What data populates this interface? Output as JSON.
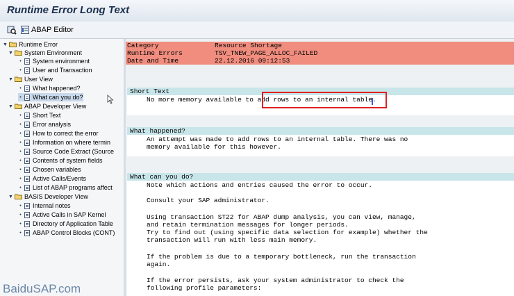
{
  "window": {
    "title": "Runtime Error Long Text"
  },
  "toolbar": {
    "abap_editor_label": "ABAP Editor"
  },
  "tree": {
    "root": "Runtime Error",
    "groups": [
      {
        "label": "System Environment",
        "items": [
          "System environment",
          "User and Transaction"
        ]
      },
      {
        "label": "User View",
        "items": [
          "What happened?",
          "What can you do?"
        ]
      },
      {
        "label": "ABAP Developer View",
        "items": [
          "Short Text",
          "Error analysis",
          "How to correct the error",
          "Information on where termin",
          "Source Code Extract (Source",
          "Contents of system fields",
          "Chosen variables",
          "Active Calls/Events",
          "List of ABAP programs affect"
        ]
      },
      {
        "label": "BASIS Developer View",
        "items": [
          "Internal notes",
          "Active Calls in SAP Kernel",
          "Directory of Application Table",
          "ABAP Control Blocks (CONT)"
        ]
      }
    ]
  },
  "header": {
    "rows": [
      {
        "label": "Category",
        "value": "Resource Shortage"
      },
      {
        "label": "Runtime Errors",
        "value": "TSV_TNEW_PAGE_ALLOC_FAILED"
      },
      {
        "label": "Date and Time",
        "value": "22.12.2016 09:12:53"
      }
    ]
  },
  "short_text": {
    "title": "Short Text",
    "lines": [
      "No more memory available to add rows to an internal table."
    ]
  },
  "what_happened": {
    "title": "What happened?",
    "lines": [
      "An attempt was made to add rows to an internal table. There was no",
      "memory available for this however."
    ]
  },
  "what_can_you_do": {
    "title": "What can you do?",
    "lines": [
      "Note which actions and entries caused the error to occur.",
      "",
      "Consult your SAP administrator.",
      "",
      "Using transaction ST22 for ABAP dump analysis, you can view, manage,",
      "and retain termination messages for longer periods.",
      "Try to find out (using specific data selection for example) whether the",
      "transaction will run with less main memory.",
      "",
      "If the problem is due to a temporary bottleneck, run the transaction",
      "again.",
      "",
      "If the error persists, ask your system administrator to check the",
      "following profile parameters:"
    ]
  },
  "watermark": "BaiduSAP.com",
  "colors": {
    "header_bg": "#f08d7e",
    "section_title_bg": "#c8e6ea",
    "highlight_box": "#e02020"
  }
}
